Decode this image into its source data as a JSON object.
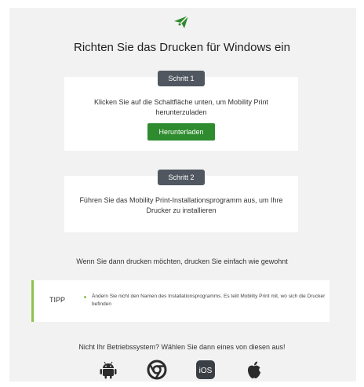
{
  "page": {
    "title": "Richten Sie das Drucken für Windows ein",
    "accent_color": "#2e8b2e",
    "logo_icon": "mobility-print-logo-icon"
  },
  "steps": [
    {
      "badge": "Schritt 1",
      "text": "Klicken Sie auf die Schaltfläche unten, um Mobility Print herunterzuladen",
      "button_label": "Herunterladen"
    },
    {
      "badge": "Schritt 2",
      "text": "Führen Sie das Mobility Print-Installationsprogramm aus, um Ihre Drucker zu installieren"
    }
  ],
  "after_note": "Wenn Sie dann drucken möchten, drucken Sie einfach wie gewohnt",
  "tip": {
    "label": "TIPP",
    "text": "Ändern Sie nicht den Namen des Installationsprogramms. Es teilt Mobility Print mit, wo sich die Drucker befinden"
  },
  "other_os": {
    "prompt": "Nicht Ihr Betriebssystem? Wählen Sie dann eines von diesen aus!",
    "icons": [
      "android-icon",
      "chrome-icon",
      "ios-icon",
      "apple-icon"
    ],
    "ios_label": "iOS"
  }
}
